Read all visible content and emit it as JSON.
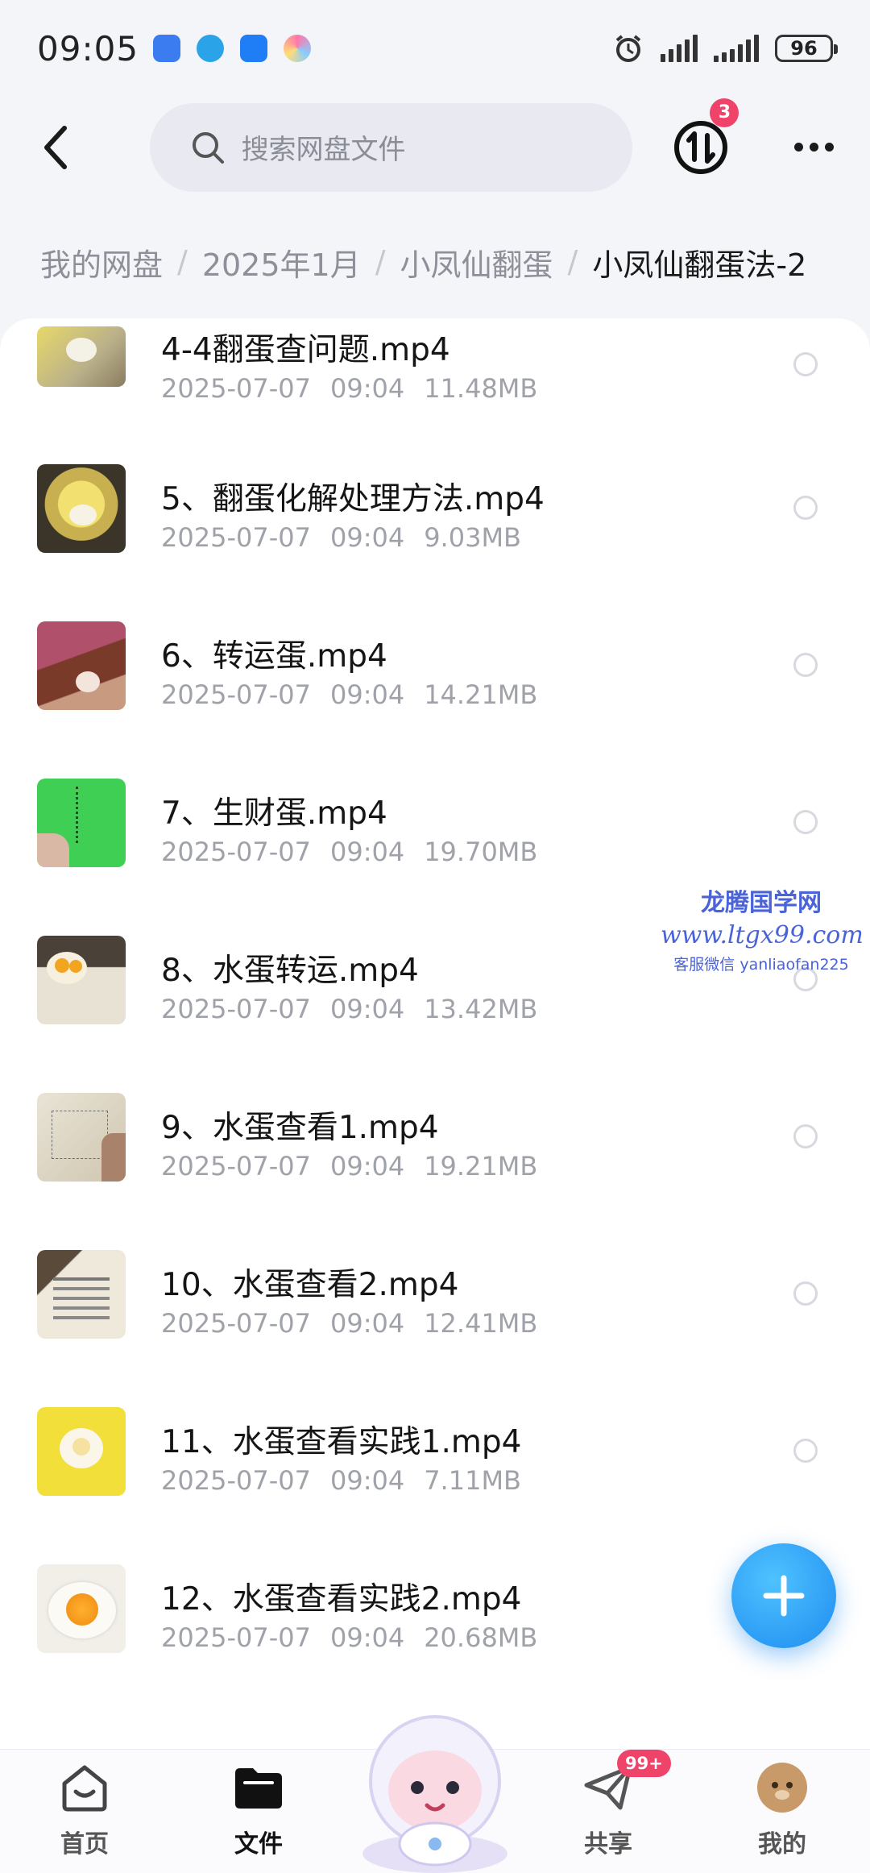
{
  "status_bar": {
    "time": "09:05",
    "battery": "96"
  },
  "header": {
    "search_placeholder": "搜索网盘文件",
    "transfer_badge": "3"
  },
  "breadcrumb": [
    "我的网盘",
    "2025年1月",
    "小凤仙翻蛋",
    "小凤仙翻蛋法-2"
  ],
  "files": [
    {
      "name": "4-4翻蛋查问题.mp4",
      "date": "2025-07-07",
      "time": "09:04",
      "size": "11.48MB"
    },
    {
      "name": "5、翻蛋化解处理方法.mp4",
      "date": "2025-07-07",
      "time": "09:04",
      "size": "9.03MB"
    },
    {
      "name": "6、转运蛋.mp4",
      "date": "2025-07-07",
      "time": "09:04",
      "size": "14.21MB"
    },
    {
      "name": "7、生财蛋.mp4",
      "date": "2025-07-07",
      "time": "09:04",
      "size": "19.70MB"
    },
    {
      "name": "8、水蛋转运.mp4",
      "date": "2025-07-07",
      "time": "09:04",
      "size": "13.42MB"
    },
    {
      "name": "9、水蛋查看1.mp4",
      "date": "2025-07-07",
      "time": "09:04",
      "size": "19.21MB"
    },
    {
      "name": "10、水蛋查看2.mp4",
      "date": "2025-07-07",
      "time": "09:04",
      "size": "12.41MB"
    },
    {
      "name": "11、水蛋查看实践1.mp4",
      "date": "2025-07-07",
      "time": "09:04",
      "size": "7.11MB"
    },
    {
      "name": "12、水蛋查看实践2.mp4",
      "date": "2025-07-07",
      "time": "09:04",
      "size": "20.68MB"
    }
  ],
  "watermark": {
    "title": "龙腾国学网",
    "url": "www.ltgx99.com",
    "contact": "客服微信 yanliaofan225"
  },
  "bottom_nav": {
    "home": "首页",
    "files": "文件",
    "share": "共享",
    "share_badge": "99+",
    "me": "我的"
  },
  "colors": {
    "accent": "#1e8cf0",
    "badge": "#f0436a",
    "meta_text": "#a0a2a9"
  }
}
